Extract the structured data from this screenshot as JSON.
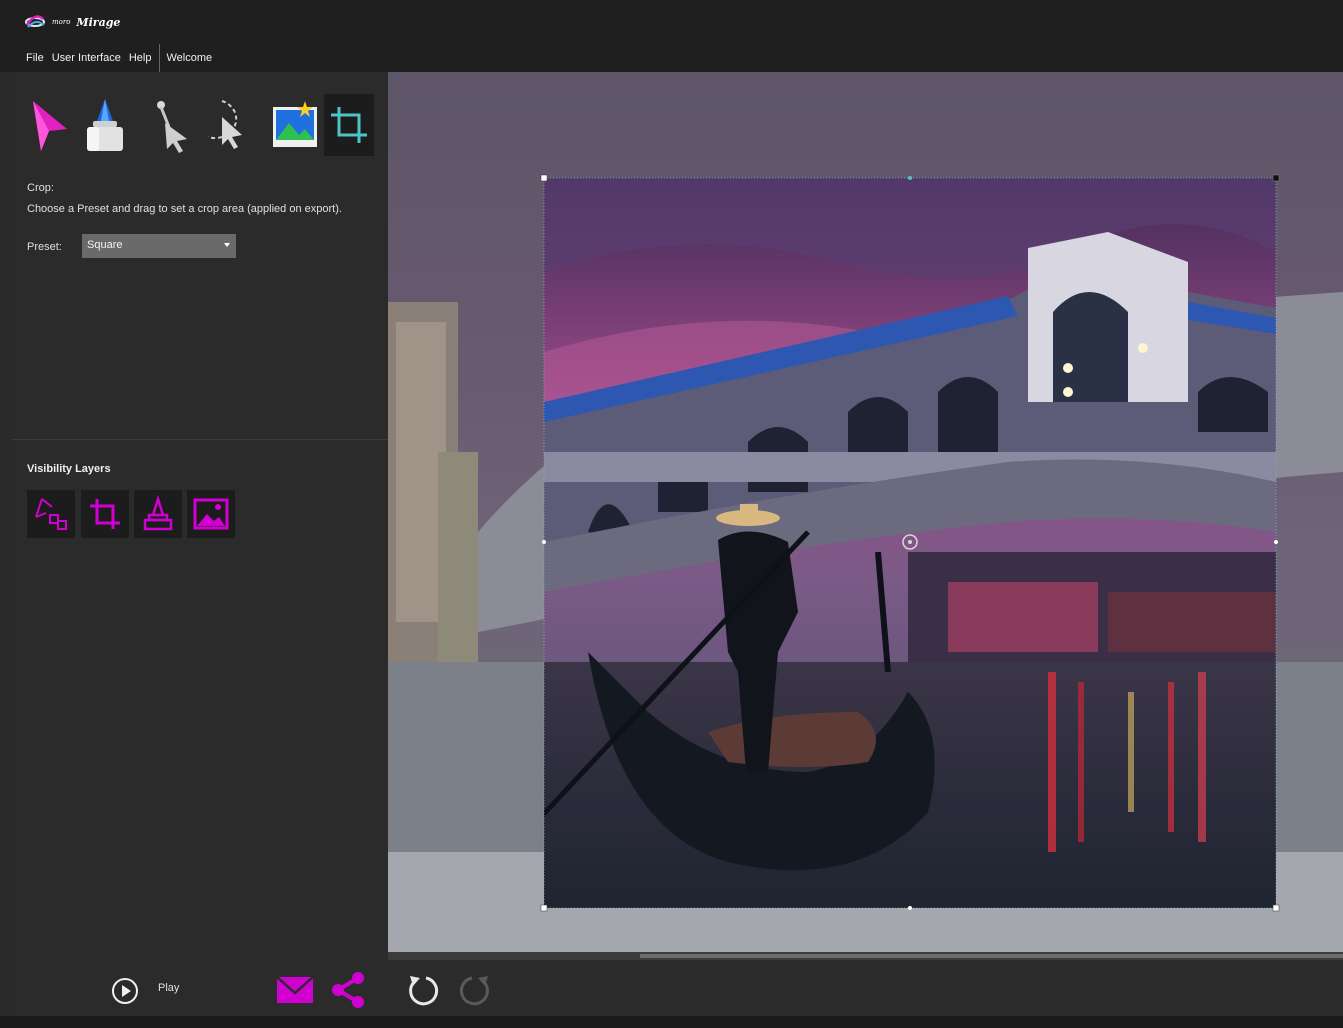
{
  "app": {
    "logo_small": "moro",
    "logo_large": "Mirage"
  },
  "menu": {
    "items": [
      "File",
      "User Interface",
      "Help"
    ],
    "welcome": "Welcome"
  },
  "toolbar": {
    "tools": [
      "select-arrow-icon",
      "eraser-icon",
      "pen-pointer-icon",
      "lasso-select-icon",
      "image-layer-icon",
      "crop-icon"
    ],
    "active_tool": "crop-icon"
  },
  "crop_panel": {
    "title": "Crop:",
    "description": "Choose a Preset and drag to set a crop area (applied on export).",
    "preset_label": "Preset:",
    "preset_value": "Square"
  },
  "visibility": {
    "title": "Visibility Layers",
    "layers": [
      "path-layer-icon",
      "crop-layer-icon",
      "stamp-layer-icon",
      "image-layer-icon"
    ]
  },
  "bottom": {
    "play_label": "Play"
  },
  "colors": {
    "accent": "#cc00cc",
    "active_crop": "#4ec4c4",
    "panel": "#2b2b2b",
    "titlebar": "#1f1f1f"
  },
  "scroll": {
    "horizontal_thumb_start": 0.26,
    "horizontal_thumb_end": 1.0
  }
}
